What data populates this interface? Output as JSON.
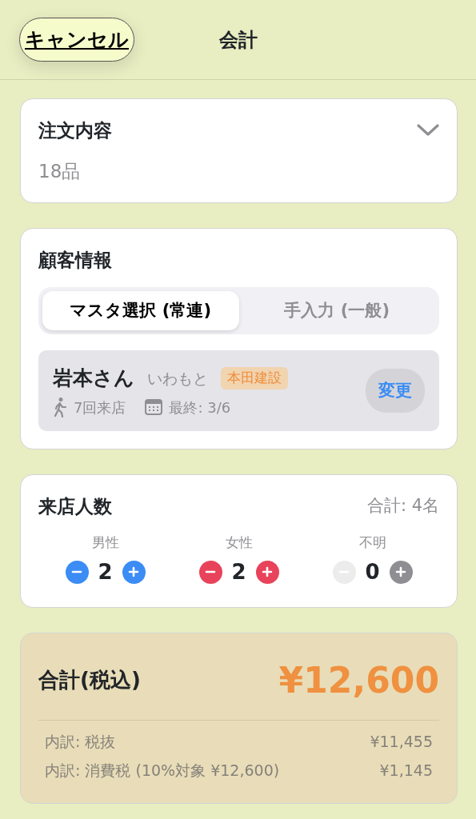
{
  "header": {
    "cancel": "キャンセル",
    "title": "会計"
  },
  "order": {
    "title": "注文内容",
    "count": "18品",
    "expanded": false
  },
  "customer": {
    "title": "顧客情報",
    "tabs": [
      {
        "label": "マスタ選択 (常連)",
        "selected": true
      },
      {
        "label": "手入力 (一般)",
        "selected": false
      }
    ],
    "name": "岩本さん",
    "reading": "いわもと",
    "company": "本田建設",
    "visits": "7回来店",
    "last": "最終: 3/6",
    "change": "変更"
  },
  "visitors": {
    "title": "来店人数",
    "total": "合計: 4名",
    "counters": [
      {
        "label": "男性",
        "value": "2",
        "color": "#3b8cf5",
        "minus_disabled": false
      },
      {
        "label": "女性",
        "value": "2",
        "color": "#e8435a",
        "minus_disabled": false
      },
      {
        "label": "不明",
        "value": "0",
        "color": "#8e8e93",
        "minus_disabled": true
      }
    ]
  },
  "total": {
    "label": "合計(税込)",
    "amount": "¥12,600",
    "breakdown": [
      {
        "label": "内訳: 税抜",
        "value": "¥11,455"
      },
      {
        "label": "内訳: 消費税 (10%対象 ¥12,600)",
        "value": "¥1,145"
      }
    ]
  }
}
